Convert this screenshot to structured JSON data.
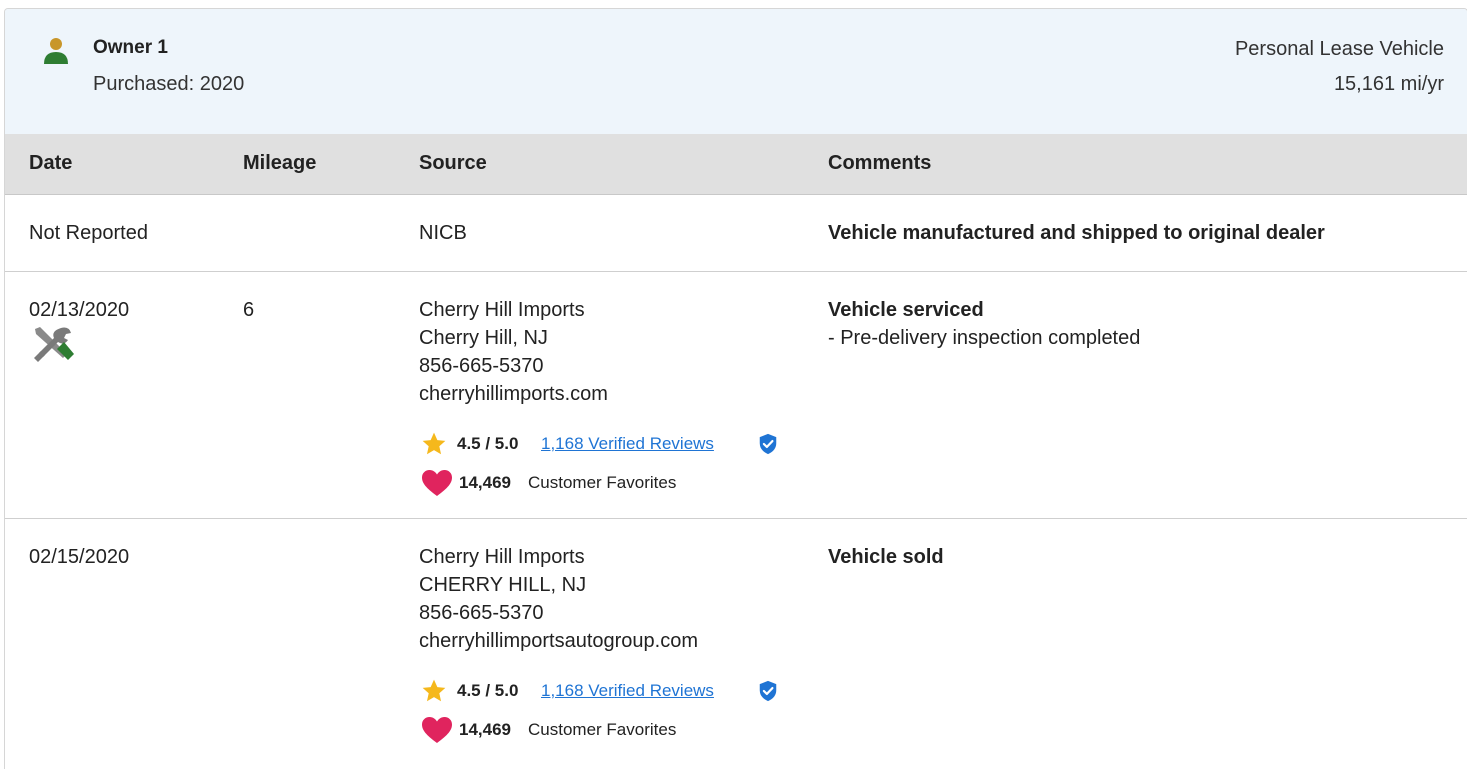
{
  "owner": {
    "title": "Owner 1",
    "purchased": "Purchased: 2020",
    "vehicle_type": "Personal Lease Vehicle",
    "miles_per_year": "15,161 mi/yr"
  },
  "table": {
    "headers": {
      "date": "Date",
      "mileage": "Mileage",
      "source": "Source",
      "comments": "Comments"
    },
    "rows": [
      {
        "date": "Not Reported",
        "mileage": "",
        "source": [
          "NICB"
        ],
        "comment_title": "Vehicle manufactured and shipped to original dealer",
        "comment_detail": ""
      },
      {
        "date": "02/13/2020",
        "icon": "service-tools-icon",
        "mileage": "6",
        "source": [
          "Cherry Hill Imports",
          "Cherry Hill, NJ",
          "856-665-5370",
          "cherryhillimports.com"
        ],
        "rating": "4.5 / 5.0",
        "reviews": "1,168 Verified Reviews",
        "favorites_count": "14,469",
        "favorites_label": "Customer Favorites",
        "comment_title": "Vehicle serviced",
        "comment_detail": "- Pre-delivery inspection completed"
      },
      {
        "date": "02/15/2020",
        "mileage": "",
        "source": [
          "Cherry Hill Imports",
          "CHERRY HILL, NJ",
          "856-665-5370",
          "cherryhillimportsautogroup.com"
        ],
        "rating": "4.5 / 5.0",
        "reviews": "1,168 Verified Reviews",
        "favorites_count": "14,469",
        "favorites_label": "Customer Favorites",
        "comment_title": "Vehicle sold",
        "comment_detail": ""
      }
    ]
  },
  "colors": {
    "header_bg": "#eef5fb",
    "table_header_bg": "#e0e0e0",
    "link": "#1f74d4",
    "star": "#f5b81c",
    "heart": "#e0245e",
    "verified": "#1f74d4",
    "owner_icon_head": "#c8962a",
    "owner_icon_body": "#2e7d32",
    "tool_green": "#2e7d32"
  },
  "icons": {
    "owner": "person-icon",
    "star": "star-icon",
    "verified": "verified-badge-icon",
    "heart": "heart-icon"
  }
}
